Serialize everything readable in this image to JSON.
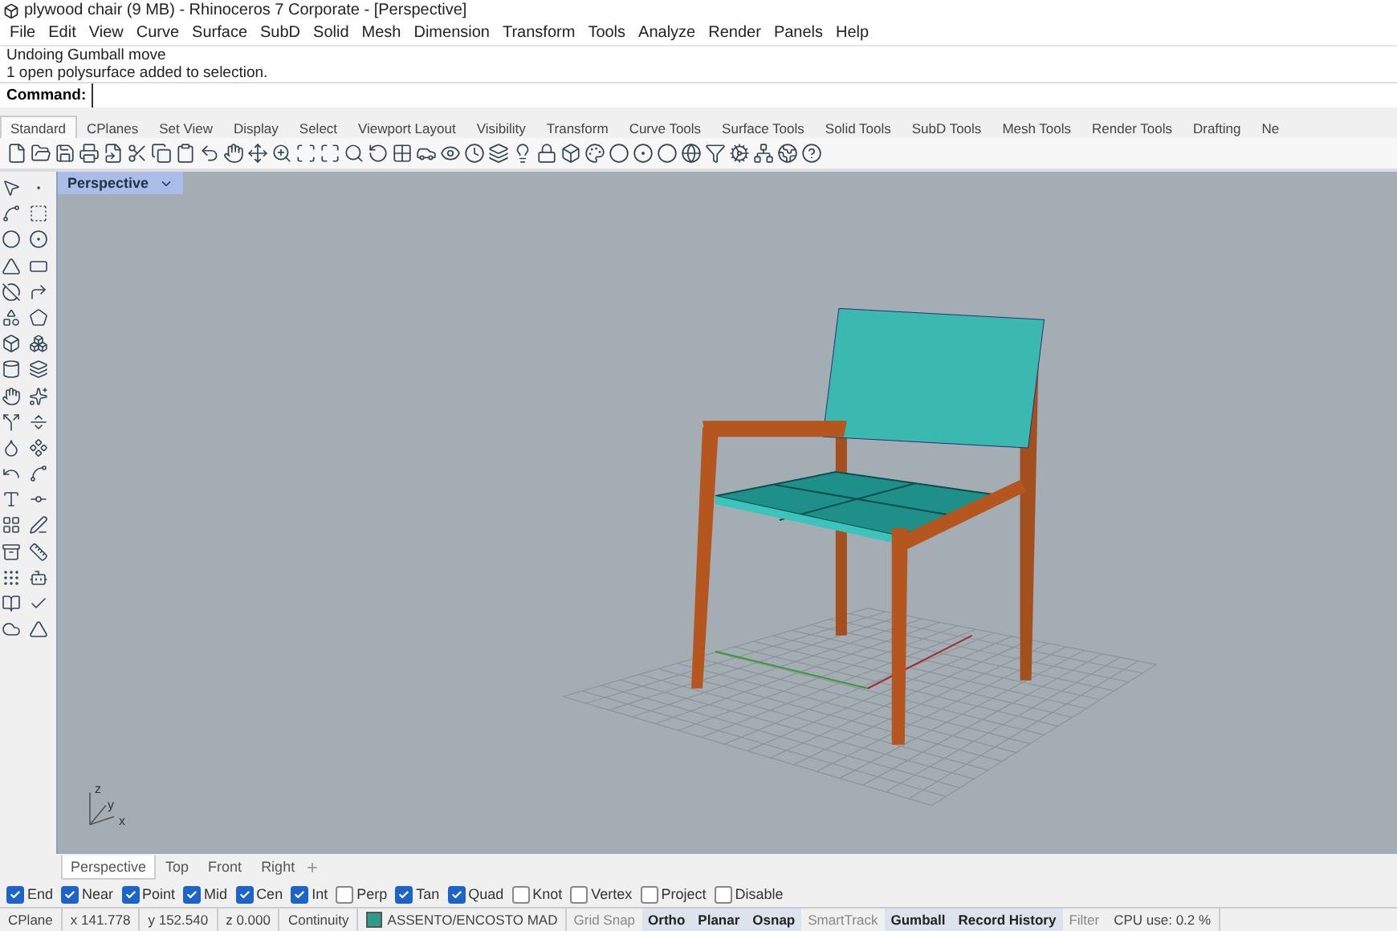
{
  "window": {
    "title": "plywood chair (9 MB) - Rhinoceros 7 Corporate - [Perspective]"
  },
  "menu": [
    "File",
    "Edit",
    "View",
    "Curve",
    "Surface",
    "SubD",
    "Solid",
    "Mesh",
    "Dimension",
    "Transform",
    "Tools",
    "Analyze",
    "Render",
    "Panels",
    "Help"
  ],
  "command_history": [
    "Undoing Gumball move",
    "1 open polysurface added to selection."
  ],
  "command": {
    "label": "Command:"
  },
  "toolbar_tabs": [
    {
      "label": "Standard",
      "selected": true
    },
    {
      "label": "CPlanes",
      "selected": false
    },
    {
      "label": "Set View",
      "selected": false
    },
    {
      "label": "Display",
      "selected": false
    },
    {
      "label": "Select",
      "selected": false
    },
    {
      "label": "Viewport Layout",
      "selected": false
    },
    {
      "label": "Visibility",
      "selected": false
    },
    {
      "label": "Transform",
      "selected": false
    },
    {
      "label": "Curve Tools",
      "selected": false
    },
    {
      "label": "Surface Tools",
      "selected": false
    },
    {
      "label": "Solid Tools",
      "selected": false
    },
    {
      "label": "SubD Tools",
      "selected": false
    },
    {
      "label": "Mesh Tools",
      "selected": false
    },
    {
      "label": "Render Tools",
      "selected": false
    },
    {
      "label": "Drafting",
      "selected": false
    },
    {
      "label": "Ne",
      "selected": false
    }
  ],
  "viewport": {
    "title": "Perspective",
    "axis_labels": [
      "z",
      "y",
      "x"
    ]
  },
  "view_tabs": [
    {
      "label": "Perspective",
      "selected": true
    },
    {
      "label": "Top",
      "selected": false
    },
    {
      "label": "Front",
      "selected": false
    },
    {
      "label": "Right",
      "selected": false
    }
  ],
  "osnaps": [
    {
      "label": "End",
      "checked": true
    },
    {
      "label": "Near",
      "checked": true
    },
    {
      "label": "Point",
      "checked": true
    },
    {
      "label": "Mid",
      "checked": true
    },
    {
      "label": "Cen",
      "checked": true
    },
    {
      "label": "Int",
      "checked": true
    },
    {
      "label": "Perp",
      "checked": false
    },
    {
      "label": "Tan",
      "checked": true
    },
    {
      "label": "Quad",
      "checked": true
    },
    {
      "label": "Knot",
      "checked": false
    },
    {
      "label": "Vertex",
      "checked": false
    },
    {
      "label": "Project",
      "checked": false
    },
    {
      "label": "Disable",
      "checked": false
    }
  ],
  "status_bar": {
    "coordinates": [
      "CPlane",
      "x 141.778",
      "y 152.540",
      "z 0.000",
      "Continuity"
    ],
    "layer": {
      "name": "ASSENTO/ENCOSTO MAD",
      "color": "#2e9a8a"
    },
    "toggles": [
      {
        "label": "Grid Snap",
        "on": false
      },
      {
        "label": "Ortho",
        "on": true
      },
      {
        "label": "Planar",
        "on": true
      },
      {
        "label": "Osnap",
        "on": true
      },
      {
        "label": "SmartTrack",
        "on": false
      },
      {
        "label": "Gumball",
        "on": true
      },
      {
        "label": "Record History",
        "on": true
      },
      {
        "label": "Filter",
        "on": false
      }
    ],
    "cpu": "CPU use: 0.2 %"
  }
}
